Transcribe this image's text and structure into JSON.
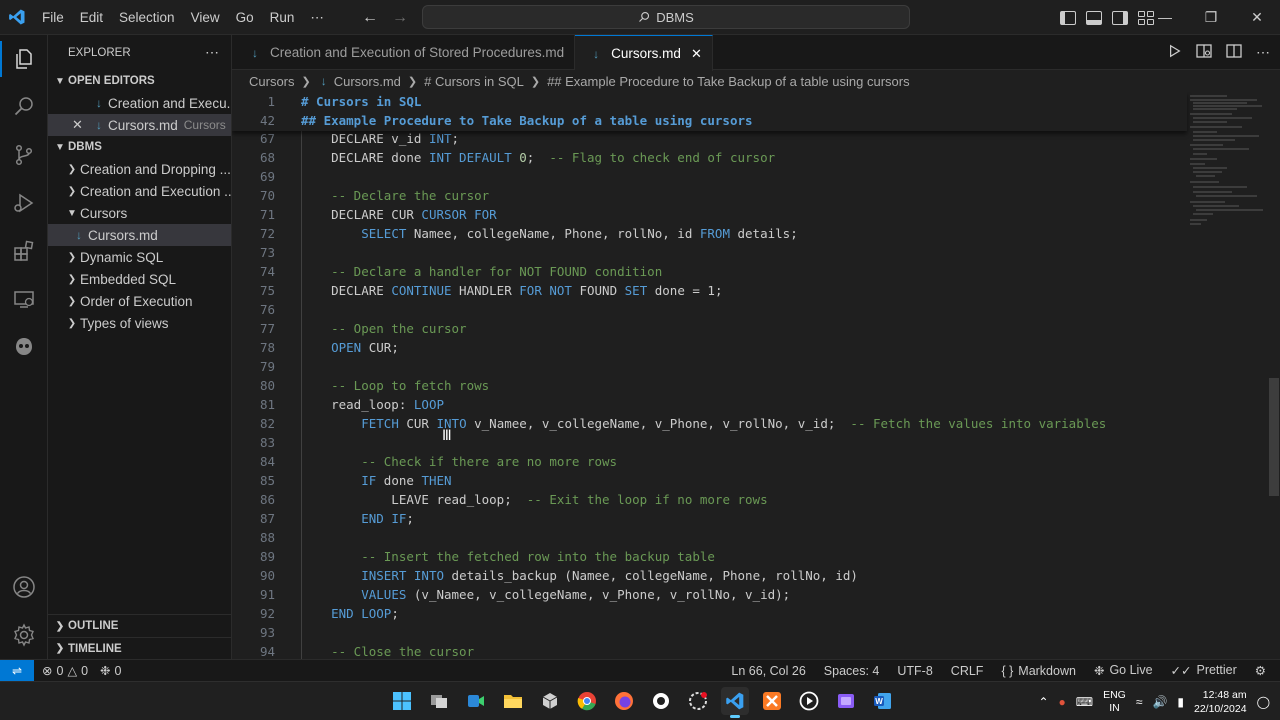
{
  "titlebar": {
    "menu": [
      "File",
      "Edit",
      "Selection",
      "View",
      "Go",
      "Run",
      "⋯"
    ],
    "search_text": "DBMS"
  },
  "sidebar": {
    "title": "EXPLORER",
    "open_editors_label": "OPEN EDITORS",
    "open_editors": [
      {
        "name": "Creation and Execu...",
        "folder": ""
      },
      {
        "name": "Cursors.md",
        "folder": "Cursors"
      }
    ],
    "workspace_label": "DBMS",
    "tree": [
      {
        "label": "Creation and Dropping ...",
        "type": "folder",
        "expanded": false
      },
      {
        "label": "Creation and Execution ...",
        "type": "folder",
        "expanded": false
      },
      {
        "label": "Cursors",
        "type": "folder",
        "expanded": true
      },
      {
        "label": "Cursors.md",
        "type": "file"
      },
      {
        "label": "Dynamic SQL",
        "type": "folder",
        "expanded": false
      },
      {
        "label": "Embedded SQL",
        "type": "folder",
        "expanded": false
      },
      {
        "label": "Order of Execution",
        "type": "folder",
        "expanded": false
      },
      {
        "label": "Types of views",
        "type": "folder",
        "expanded": false
      }
    ],
    "outline_label": "OUTLINE",
    "timeline_label": "TIMELINE"
  },
  "tabs": [
    {
      "label": "Creation and Execution of Stored Procedures.md",
      "active": false
    },
    {
      "label": "Cursors.md",
      "active": true
    }
  ],
  "breadcrumb": [
    "Cursors",
    "Cursors.md",
    "# Cursors in SQL",
    "## Example Procedure to Take Backup of a table using cursors"
  ],
  "sticky_lines": [
    {
      "num": "1",
      "text": "# Cursors in SQL"
    },
    {
      "num": "42",
      "text": "## Example Procedure to Take Backup of a table using cursors"
    }
  ],
  "code_lines": [
    {
      "num": "67",
      "tokens": [
        [
          "kw",
          ""
        ],
        [
          "",
          "    DECLARE v_id "
        ],
        [
          "kw",
          "INT"
        ],
        [
          "",
          ";"
        ]
      ]
    },
    {
      "num": "68",
      "tokens": [
        [
          "",
          "    DECLARE done "
        ],
        [
          "kw",
          "INT DEFAULT "
        ],
        [
          "num",
          "0"
        ],
        [
          "",
          ";  "
        ],
        [
          "cm",
          "-- Flag to check end of cursor"
        ]
      ]
    },
    {
      "num": "69",
      "tokens": []
    },
    {
      "num": "70",
      "tokens": [
        [
          "cm",
          "    -- Declare the cursor"
        ]
      ]
    },
    {
      "num": "71",
      "tokens": [
        [
          "",
          "    DECLARE CUR "
        ],
        [
          "kw",
          "CURSOR FOR"
        ]
      ]
    },
    {
      "num": "72",
      "tokens": [
        [
          "",
          "        "
        ],
        [
          "kw",
          "SELECT"
        ],
        [
          "",
          " Namee, collegeName, Phone, rollNo, id "
        ],
        [
          "kw",
          "FROM"
        ],
        [
          "",
          " details;"
        ]
      ]
    },
    {
      "num": "73",
      "tokens": []
    },
    {
      "num": "74",
      "tokens": [
        [
          "cm",
          "    -- Declare a handler for NOT FOUND condition"
        ]
      ]
    },
    {
      "num": "75",
      "tokens": [
        [
          "",
          "    DECLARE "
        ],
        [
          "kw",
          "CONTINUE"
        ],
        [
          "",
          " HANDLER "
        ],
        [
          "kw",
          "FOR NOT"
        ],
        [
          "",
          " FOUND "
        ],
        [
          "kw",
          "SET"
        ],
        [
          "",
          " done = 1;"
        ]
      ]
    },
    {
      "num": "76",
      "tokens": []
    },
    {
      "num": "77",
      "tokens": [
        [
          "cm",
          "    -- Open the cursor"
        ]
      ]
    },
    {
      "num": "78",
      "tokens": [
        [
          "",
          "    "
        ],
        [
          "kw",
          "OPEN"
        ],
        [
          "",
          " CUR;"
        ]
      ]
    },
    {
      "num": "79",
      "tokens": []
    },
    {
      "num": "80",
      "tokens": [
        [
          "cm",
          "    -- Loop to fetch rows"
        ]
      ]
    },
    {
      "num": "81",
      "tokens": [
        [
          "",
          "    read_loop: "
        ],
        [
          "kw",
          "LOOP"
        ]
      ]
    },
    {
      "num": "82",
      "tokens": [
        [
          "",
          "        "
        ],
        [
          "kw",
          "FETCH"
        ],
        [
          "",
          " CUR "
        ],
        [
          "kw",
          "INTO"
        ],
        [
          "",
          " v_Namee, v_collegeName, v_Phone, v_rollNo, v_id;  "
        ],
        [
          "cm",
          "-- Fetch the values into variables"
        ]
      ]
    },
    {
      "num": "83",
      "tokens": []
    },
    {
      "num": "84",
      "tokens": [
        [
          "cm",
          "        -- Check if there are no more rows"
        ]
      ]
    },
    {
      "num": "85",
      "tokens": [
        [
          "",
          "        "
        ],
        [
          "kw",
          "IF"
        ],
        [
          "",
          " done "
        ],
        [
          "kw",
          "THEN"
        ]
      ]
    },
    {
      "num": "86",
      "tokens": [
        [
          "",
          "            LEAVE read_loop;  "
        ],
        [
          "cm",
          "-- Exit the loop if no more rows"
        ]
      ]
    },
    {
      "num": "87",
      "tokens": [
        [
          "",
          "        "
        ],
        [
          "kw",
          "END IF"
        ],
        [
          "",
          ";"
        ]
      ]
    },
    {
      "num": "88",
      "tokens": []
    },
    {
      "num": "89",
      "tokens": [
        [
          "cm",
          "        -- Insert the fetched row into the backup table"
        ]
      ]
    },
    {
      "num": "90",
      "tokens": [
        [
          "",
          "        "
        ],
        [
          "kw",
          "INSERT INTO"
        ],
        [
          "",
          " details_backup (Namee, collegeName, Phone, rollNo, id)"
        ]
      ]
    },
    {
      "num": "91",
      "tokens": [
        [
          "",
          "        "
        ],
        [
          "kw",
          "VALUES"
        ],
        [
          "",
          " (v_Namee, v_collegeName, v_Phone, v_rollNo, v_id);"
        ]
      ]
    },
    {
      "num": "92",
      "tokens": [
        [
          "",
          "    "
        ],
        [
          "kw",
          "END LOOP"
        ],
        [
          "",
          ";"
        ]
      ]
    },
    {
      "num": "93",
      "tokens": []
    },
    {
      "num": "94",
      "tokens": [
        [
          "cm",
          "    -- Close the cursor"
        ]
      ]
    }
  ],
  "statusbar": {
    "errors": "0",
    "warnings": "0",
    "ports": "0",
    "position": "Ln 66, Col 26",
    "spaces": "Spaces: 4",
    "encoding": "UTF-8",
    "eol": "CRLF",
    "language": "Markdown",
    "golive": "Go Live",
    "prettier": "Prettier"
  },
  "taskbar": {
    "lang_line1": "ENG",
    "lang_line2": "IN",
    "time": "12:48 am",
    "date": "22/10/2024"
  },
  "colors": {
    "accent": "#0078d4",
    "keyword": "#569cd6",
    "comment": "#6a9955",
    "number": "#b5cea8"
  }
}
